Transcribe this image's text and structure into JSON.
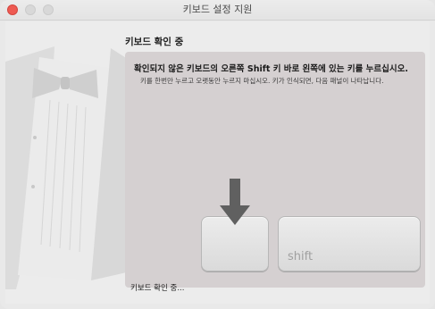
{
  "window": {
    "title": "키보드 설정 지원"
  },
  "main": {
    "heading": "키보드 확인 중",
    "instruction": "확인되지 않은 키보드의 오른쪽 Shift 키 바로 왼쪽에 있는 키를 누르십시오.",
    "subinstruction": "키를 한번만 누르고 오랫동안 누르지 마십시오. 키가 인식되면, 다음 패널이 나타납니다.",
    "shift_key_label": "shift",
    "status": "키보드 확인 중..."
  },
  "icons": {
    "illustration": "tuxedo-keyboard-illustration",
    "arrow": "down-arrow-icon"
  },
  "colors": {
    "close_button": "#ee5a52",
    "panel": "#d5d0d1",
    "arrow": "#606060"
  }
}
